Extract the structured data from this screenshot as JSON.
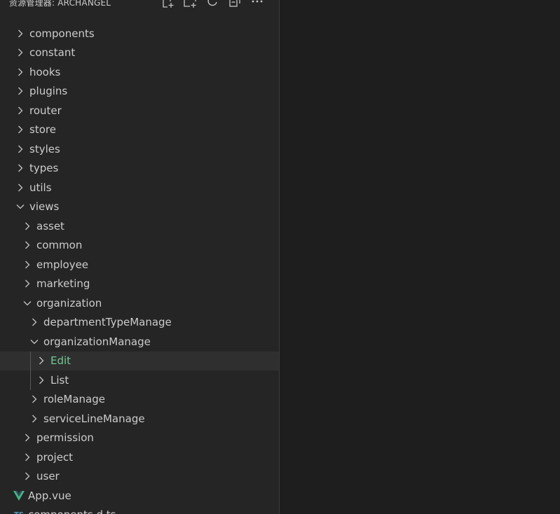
{
  "explorer": {
    "title": "资源管理器: ARCHANGEL",
    "actions": [
      {
        "name": "new-file-icon"
      },
      {
        "name": "new-folder-icon"
      },
      {
        "name": "refresh-icon"
      },
      {
        "name": "collapse-all-icon"
      },
      {
        "name": "more-actions-icon"
      }
    ]
  },
  "tree": [
    {
      "label": "components",
      "kind": "folder",
      "expanded": false,
      "depth": 0
    },
    {
      "label": "constant",
      "kind": "folder",
      "expanded": false,
      "depth": 0
    },
    {
      "label": "hooks",
      "kind": "folder",
      "expanded": false,
      "depth": 0
    },
    {
      "label": "plugins",
      "kind": "folder",
      "expanded": false,
      "depth": 0
    },
    {
      "label": "router",
      "kind": "folder",
      "expanded": false,
      "depth": 0
    },
    {
      "label": "store",
      "kind": "folder",
      "expanded": false,
      "depth": 0
    },
    {
      "label": "styles",
      "kind": "folder",
      "expanded": false,
      "depth": 0
    },
    {
      "label": "types",
      "kind": "folder",
      "expanded": false,
      "depth": 0
    },
    {
      "label": "utils",
      "kind": "folder",
      "expanded": false,
      "depth": 0
    },
    {
      "label": "views",
      "kind": "folder",
      "expanded": true,
      "depth": 0
    },
    {
      "label": "asset",
      "kind": "folder",
      "expanded": false,
      "depth": 1
    },
    {
      "label": "common",
      "kind": "folder",
      "expanded": false,
      "depth": 1
    },
    {
      "label": "employee",
      "kind": "folder",
      "expanded": false,
      "depth": 1
    },
    {
      "label": "marketing",
      "kind": "folder",
      "expanded": false,
      "depth": 1
    },
    {
      "label": "organization",
      "kind": "folder",
      "expanded": true,
      "depth": 1
    },
    {
      "label": "departmentTypeManage",
      "kind": "folder",
      "expanded": false,
      "depth": 2
    },
    {
      "label": "organizationManage",
      "kind": "folder",
      "expanded": true,
      "depth": 2
    },
    {
      "label": "Edit",
      "kind": "folder",
      "expanded": false,
      "depth": 3,
      "selected": true,
      "status_color": "#73c991"
    },
    {
      "label": "List",
      "kind": "folder",
      "expanded": false,
      "depth": 3
    },
    {
      "label": "roleManage",
      "kind": "folder",
      "expanded": false,
      "depth": 2
    },
    {
      "label": "serviceLineManage",
      "kind": "folder",
      "expanded": false,
      "depth": 2
    },
    {
      "label": "permission",
      "kind": "folder",
      "expanded": false,
      "depth": 1
    },
    {
      "label": "project",
      "kind": "folder",
      "expanded": false,
      "depth": 1
    },
    {
      "label": "user",
      "kind": "folder",
      "expanded": false,
      "depth": 1
    },
    {
      "label": "App.vue",
      "kind": "file",
      "icon": "vue-icon",
      "icon_color": "#41b883",
      "depth": 0
    },
    {
      "label": "components.d.ts",
      "kind": "file",
      "icon": "typescript-icon",
      "icon_badge": "TS",
      "icon_color": "#519aba",
      "depth": 0
    }
  ],
  "colors": {
    "sidebar_bg": "#252526",
    "editor_bg": "#1e1e1e",
    "text": "#cccccc",
    "selected_bg": "#2f2f30",
    "modified_green": "#73c991",
    "indent_guide": "#585858"
  }
}
